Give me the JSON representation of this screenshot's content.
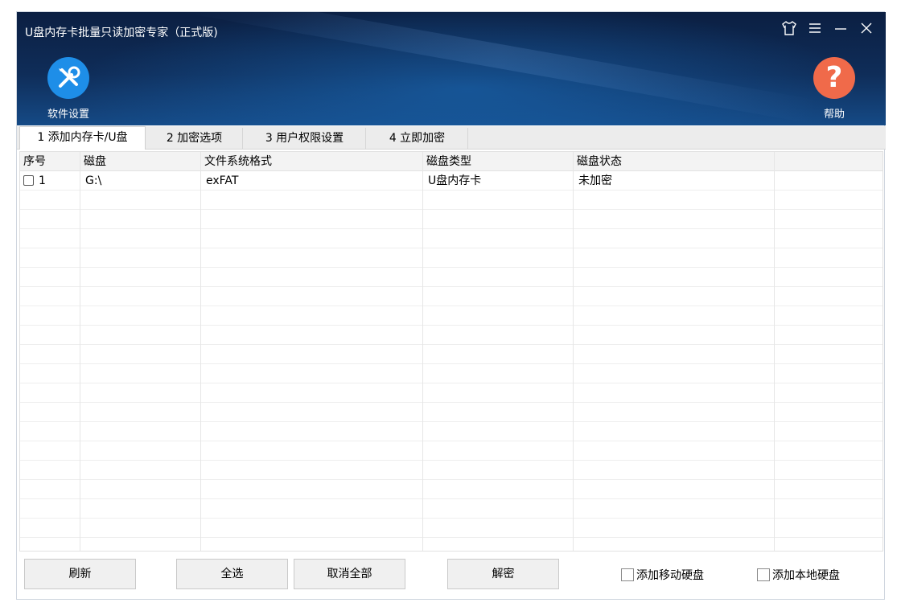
{
  "window": {
    "title": "U盘内存卡批量只读加密专家（正式版)"
  },
  "toolbar": {
    "settings_label": "软件设置",
    "help_label": "帮助"
  },
  "colors": {
    "settings_icon_bg": "#1e8ee8",
    "help_icon_bg": "#f06a4a",
    "header_dark": "#0b1f42"
  },
  "tabs": [
    {
      "label": "1 添加内存卡/U盘",
      "active": true
    },
    {
      "label": "2 加密选项"
    },
    {
      "label": "3 用户权限设置"
    },
    {
      "label": "4 立即加密"
    }
  ],
  "table": {
    "columns": [
      "序号",
      "磁盘",
      "文件系统格式",
      "磁盘类型",
      "磁盘状态"
    ],
    "rows": [
      {
        "index": "1",
        "disk": "G:\\",
        "fs": "exFAT",
        "type": "U盘内存卡",
        "status": "未加密"
      }
    ]
  },
  "buttons": {
    "refresh": "刷新",
    "select_all": "全选",
    "deselect_all": "取消全部",
    "decrypt": "解密"
  },
  "options": {
    "add_removable": "添加移动硬盘",
    "add_local": "添加本地硬盘"
  }
}
